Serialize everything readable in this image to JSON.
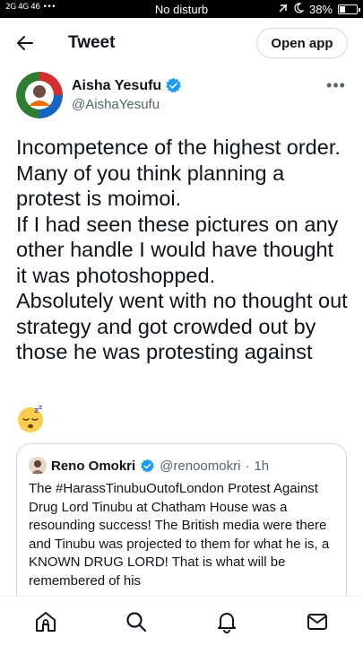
{
  "status_bar": {
    "network": "2G 4G 46",
    "dots": "•••",
    "center_text": "No disturb",
    "battery": "38%",
    "battery_level": 0.38
  },
  "header": {
    "title": "Tweet",
    "open_app_label": "Open app"
  },
  "author": {
    "name": "Aisha Yesufu",
    "handle": "@AishaYesufu",
    "verified": true,
    "more_label": "•••"
  },
  "tweet": {
    "text": "Incompetence of the highest order. Many of you think planning a protest is moimoi.\nIf I had seen these pictures on any other handle I would have thought it was photoshopped.\nAbsolutely went with no thought out strategy and got crowded out by those he was protesting against",
    "emoji": "sleeping-face-emoji"
  },
  "quote": {
    "name": "Reno Omokri",
    "handle": "@renoomokri",
    "separator": "·",
    "time": "1h",
    "text": "The #HarassTinubuOutofLondon Protest Against Drug Lord Tinubu at Chatham House was a resounding success! The British media were there and Tinubu was projected to them for what he is, a KNOWN DRUG LORD! That is what will be remembered of his"
  },
  "bottom_nav": {
    "items": [
      "home-icon",
      "search-icon",
      "notifications-icon",
      "messages-icon"
    ]
  },
  "colors": {
    "primary_text": "#0f1419",
    "secondary_text": "#536471",
    "verified_blue": "#1d9bf0",
    "border": "#cfd9de"
  }
}
